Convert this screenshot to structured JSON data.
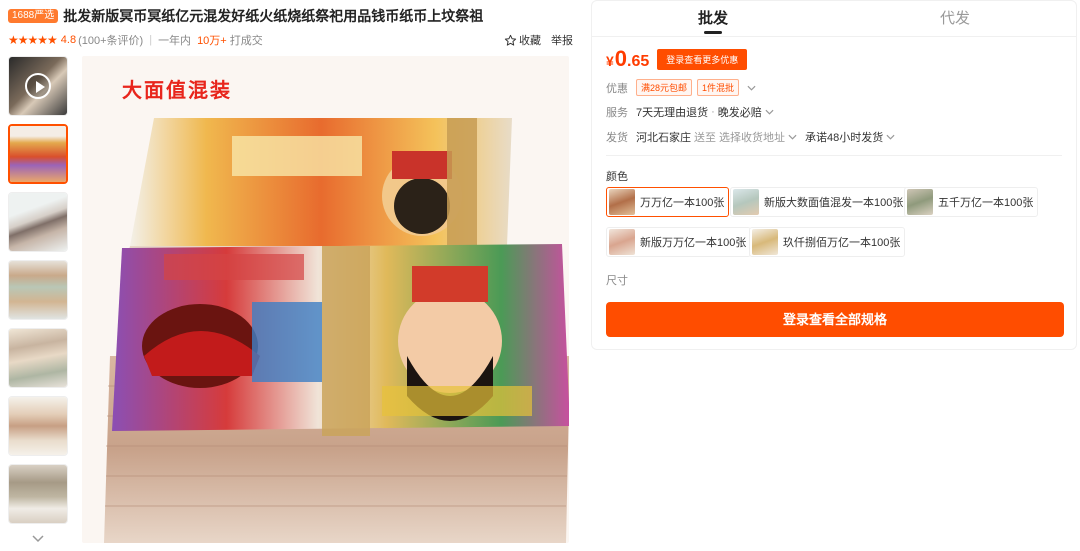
{
  "header": {
    "badge": "1688严选",
    "title": "批发新版冥币冥纸亿元混发好纸火纸烧纸祭祀用品钱币纸币上坟祭祖",
    "rating": "4.8",
    "reviews": "(100+条评价)",
    "period": "一年内",
    "sales_count": "10万+",
    "sales_suffix": "打成交",
    "favorite_label": "收藏",
    "report_label": "举报"
  },
  "gallery": {
    "banner_text": "大面值混装"
  },
  "tabs": [
    {
      "label": "批发"
    },
    {
      "label": "代发"
    }
  ],
  "price": {
    "currency": "¥",
    "integer": "0",
    "decimal": ".65",
    "login_button": "登录查看更多优惠"
  },
  "promo": {
    "label": "优惠",
    "tags": [
      "满28元包邮",
      "1件混批"
    ]
  },
  "service": {
    "label": "服务",
    "items": [
      "7天无理由退货",
      "晚发必赔"
    ]
  },
  "shipping": {
    "label": "发货",
    "origin": "河北石家庄",
    "to": "送至",
    "address_placeholder": "选择收货地址",
    "promise": "承诺48小时发货"
  },
  "color": {
    "label": "颜色",
    "options": [
      "万万亿一本100张",
      "新版大数面值混发一本100张",
      "五千万亿一本100张",
      "新版万万亿一本100张",
      "玖仟捌佰万亿一本100张"
    ],
    "selected_index": 0
  },
  "size": {
    "label": "尺寸"
  },
  "cta": {
    "label": "登录查看全部规格"
  }
}
